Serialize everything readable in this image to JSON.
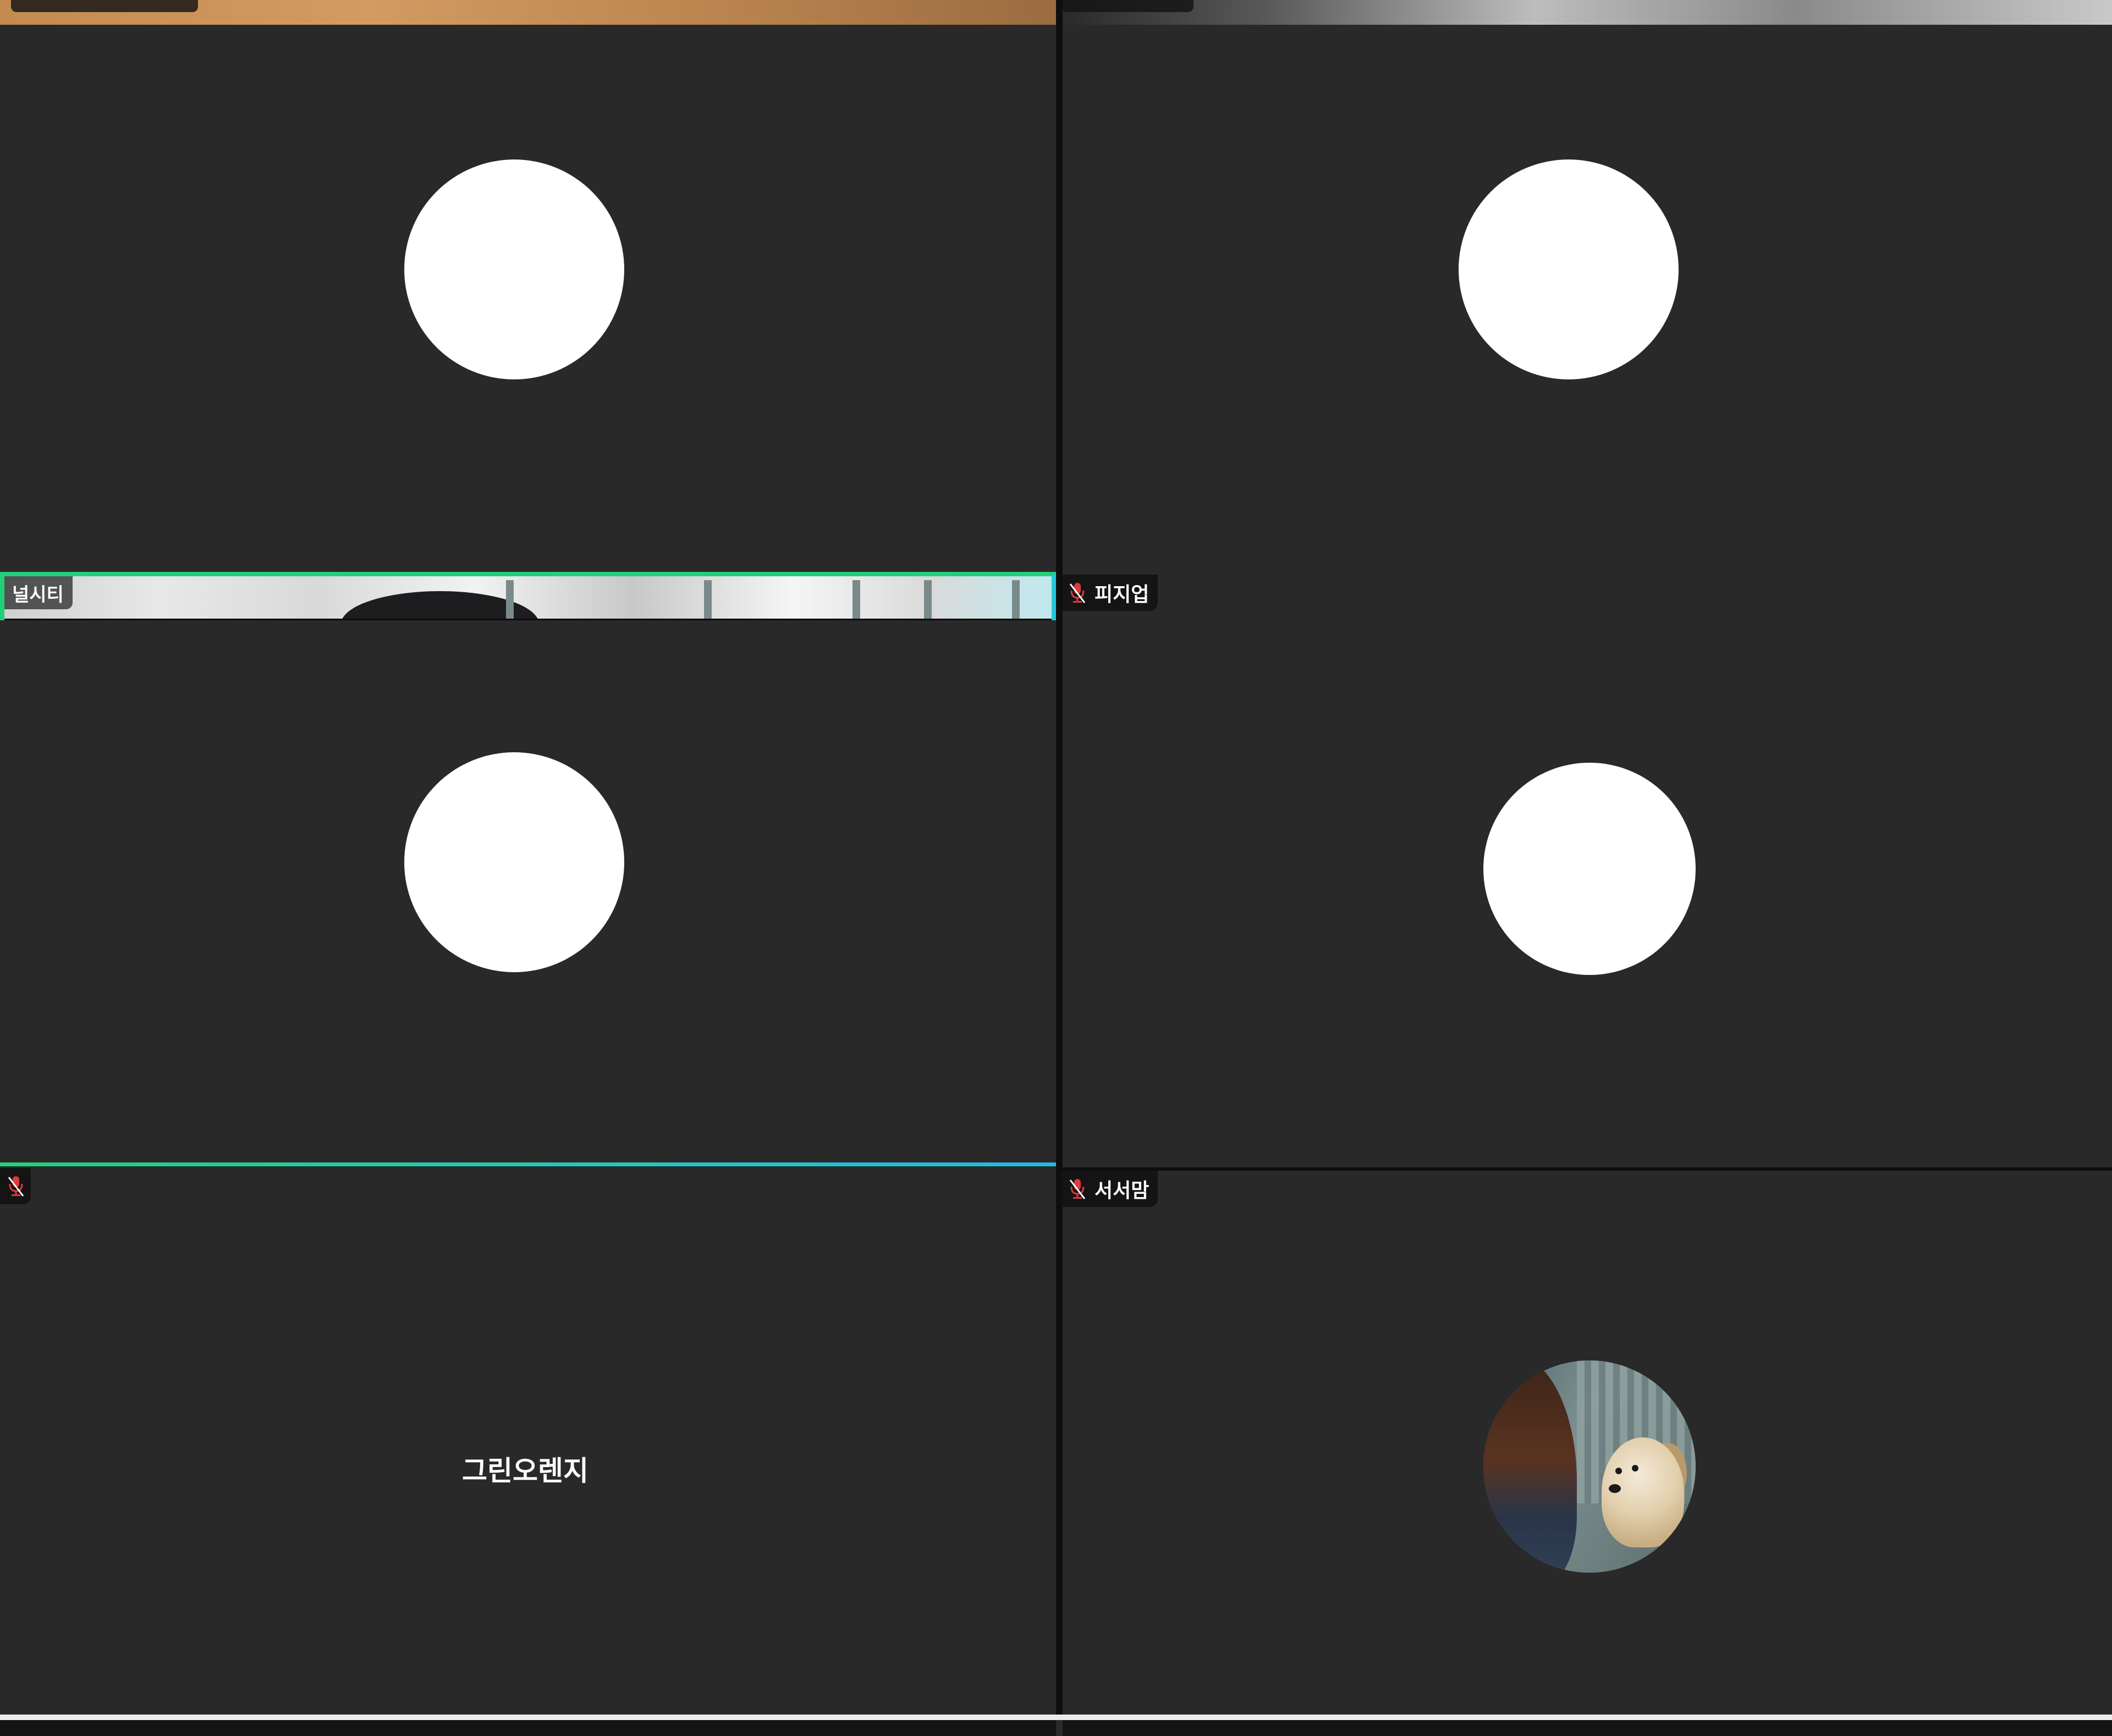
{
  "participants": {
    "tile_1": {
      "name": ""
    },
    "tile_2": {
      "name": ""
    },
    "tile_3": {
      "name": "널시티"
    },
    "tile_4": {
      "name": "피지업"
    },
    "tile_5": {
      "name": "",
      "display_name": "그린오렌지"
    },
    "tile_6": {
      "name": "서서맘"
    }
  },
  "icons": {
    "mic_muted": "mic-muted-icon"
  },
  "colors": {
    "tile_bg": "#292929",
    "active_speaker": "#23d07a",
    "active_speaker_alt": "#26c6da",
    "mute_red": "#e0393e",
    "name_tag_bg": "#121212"
  }
}
